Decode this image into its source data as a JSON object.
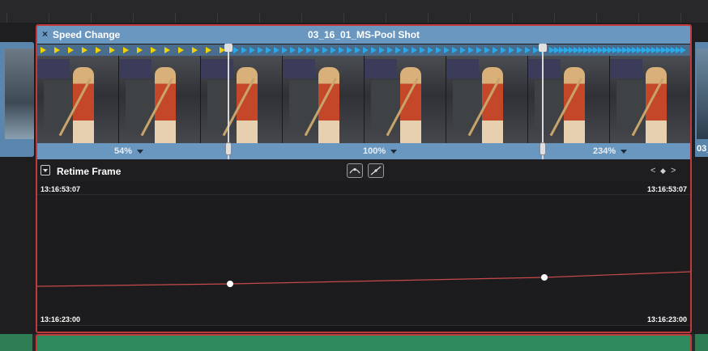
{
  "clip": {
    "close_glyph": "×",
    "speed_label": "Speed Change",
    "name": "03_16_01_MS-Pool Shot"
  },
  "next_clip": {
    "label": "03_"
  },
  "speed_segments": [
    {
      "label": "54%"
    },
    {
      "label": "100%"
    },
    {
      "label": "234%"
    }
  ],
  "curve_editor": {
    "title": "Retime Frame",
    "tools": [
      "curve-ease-icon",
      "curve-linear-icon"
    ],
    "nav_prev": "<",
    "nav_keyframe": "◆",
    "nav_next": ">",
    "timecode_top_left": "13:16:53:07",
    "timecode_top_right": "13:16:53:07",
    "timecode_bottom_left": "13:16:23:00",
    "timecode_bottom_right": "13:16:23:00"
  },
  "colors": {
    "clip_header": "#6a97bf",
    "selection_border": "#c0393b",
    "curve_line": "#c74a4a",
    "arrow_slow": "#f2d100",
    "arrow_fast": "#2aa8e8",
    "audio_track": "#2e8a5c"
  }
}
